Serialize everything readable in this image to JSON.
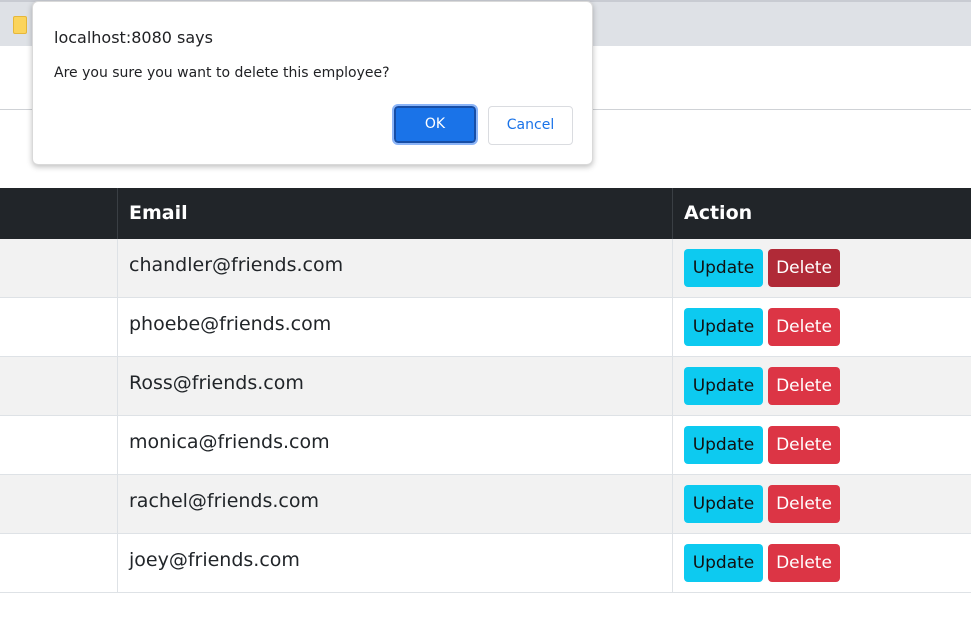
{
  "dialog": {
    "title": "localhost:8080 says",
    "message": "Are you sure you want to delete this employee?",
    "ok_label": "OK",
    "cancel_label": "Cancel"
  },
  "table": {
    "headers": [
      "",
      "Email",
      "Action"
    ],
    "rows": [
      {
        "email": "chandler@friends.com",
        "update_label": "Update",
        "delete_label": "Delete"
      },
      {
        "email": "phoebe@friends.com",
        "update_label": "Update",
        "delete_label": "Delete"
      },
      {
        "email": "Ross@friends.com",
        "update_label": "Update",
        "delete_label": "Delete"
      },
      {
        "email": "monica@friends.com",
        "update_label": "Update",
        "delete_label": "Delete"
      },
      {
        "email": "rachel@friends.com",
        "update_label": "Update",
        "delete_label": "Delete"
      },
      {
        "email": "joey@friends.com",
        "update_label": "Update",
        "delete_label": "Delete"
      }
    ]
  },
  "colors": {
    "header_bg": "#212529",
    "update_btn": "#0dcaf0",
    "delete_btn": "#dc3545",
    "dialog_ok": "#1a73e8"
  },
  "icons": {
    "tab_favicon": "page-icon"
  }
}
